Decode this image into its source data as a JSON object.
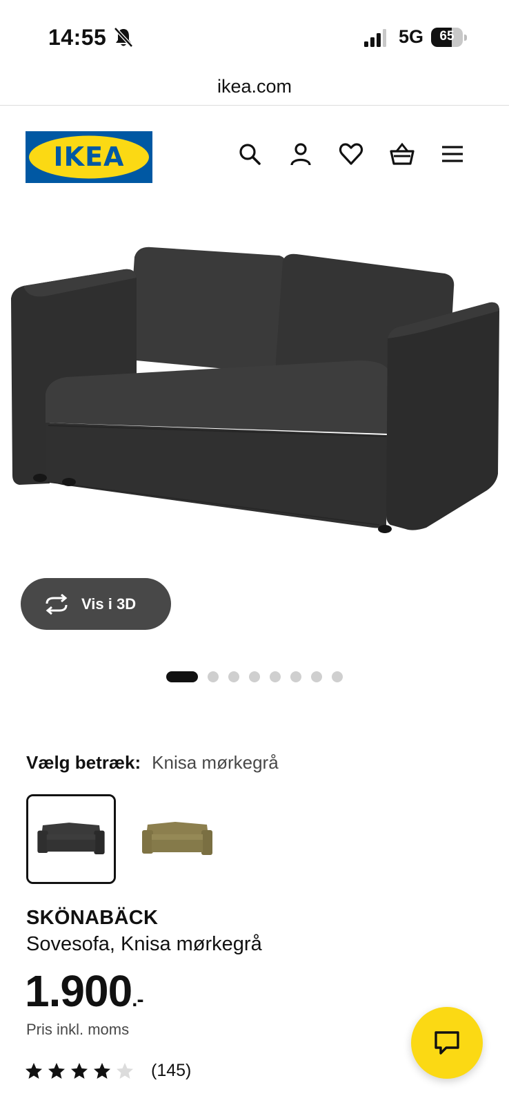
{
  "status_bar": {
    "time": "14:55",
    "network": "5G",
    "battery_percent": "65",
    "battery_level": 0.65
  },
  "browser": {
    "url": "ikea.com"
  },
  "header": {
    "logo_text": "IKEA",
    "icons": [
      "search-icon",
      "account-icon",
      "heart-icon",
      "basket-icon",
      "menu-icon"
    ]
  },
  "gallery": {
    "view_3d_label": "Vis i 3D",
    "image_count": 8,
    "active_index": 0
  },
  "cover": {
    "label": "Vælg betræk:",
    "selected_value": "Knisa mørkegrå",
    "options": [
      {
        "color": "#3a3a3a",
        "selected": true
      },
      {
        "color": "#8c7f4e",
        "selected": false
      }
    ]
  },
  "product": {
    "name": "SKÖNABÄCK",
    "description": "Sovesofa, Knisa mørkegrå",
    "price": "1.900",
    "price_suffix": ".-",
    "price_note": "Pris inkl. moms",
    "rating": 4,
    "rating_max": 5,
    "review_count": "(145)"
  },
  "colors": {
    "ikea_blue": "#0058a3",
    "ikea_yellow": "#fbd914",
    "button_dark": "#484848"
  }
}
